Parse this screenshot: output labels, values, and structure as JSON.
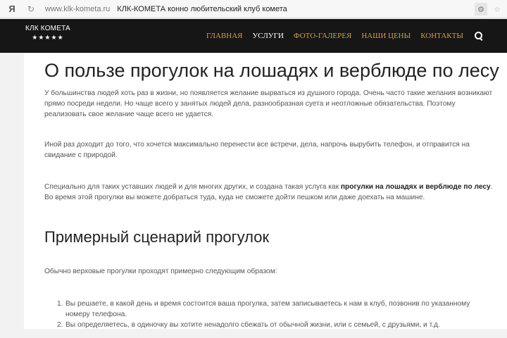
{
  "browser": {
    "logo": "Я",
    "reload_glyph": "↻",
    "url": "www.klk-kometa.ru",
    "title": "КЛК-КОМЕТА конно любительский клуб комета",
    "settings_icon": "gear-icon",
    "bookmark_icon": "star-icon"
  },
  "header": {
    "logo_name": "КЛК КОМЕТА",
    "logo_stars": "★★★★★",
    "nav": [
      {
        "label": "ГЛАВНАЯ"
      },
      {
        "label": "УСЛУГИ"
      },
      {
        "label": "ФОТО-ГАЛЕРЕЯ"
      },
      {
        "label": "НАШИ ЦЕНЫ"
      },
      {
        "label": "КОНТАКТЫ"
      }
    ],
    "accent_color": "#c9a24a"
  },
  "article": {
    "title": "О пользе прогулок на лошадях и верблюде по лесу",
    "p1": "У большинства людей хоть раз в жизни, но появляется желание вырваться из душного города. Очень часто такие желания возникают прямо посреди недели. Но чаще всего у занятых людей дела, разнообразная суета и неотложные обязательства. Поэтому реализовать свое желание чаще всего не удается.",
    "p2": "Иной раз доходит до того, что хочется максимально перенести все встречи, дела, напрочь вырубить телефон, и отправится на свидание с природой.",
    "p3_start": "Специально для таких уставших людей и для многих других, и создана такая услуга как ",
    "p3_bold": "прогулки на лошадях и верблюде по лесу",
    "p3_end": ". Во время этой прогулки вы можете добраться туда, куда не сможете дойти пешком или даже доехать на машине.",
    "subtitle": "Примерный сценарий прогулок",
    "p4": "Обычно верховые прогулки проходят примерно следующим образом:",
    "list": [
      {
        "num": "1.",
        "text": "Вы решаете, в какой день и время состоится ваша прогулка, затем записываетесь к нам в клуб, позвонив по указанному номеру телефона."
      },
      {
        "num": "2.",
        "text": "Вы определяетесь, в одиночку вы хотите ненадолго сбежать от обычной жизни, или с семьей, с друзьями, и т.д."
      }
    ]
  }
}
